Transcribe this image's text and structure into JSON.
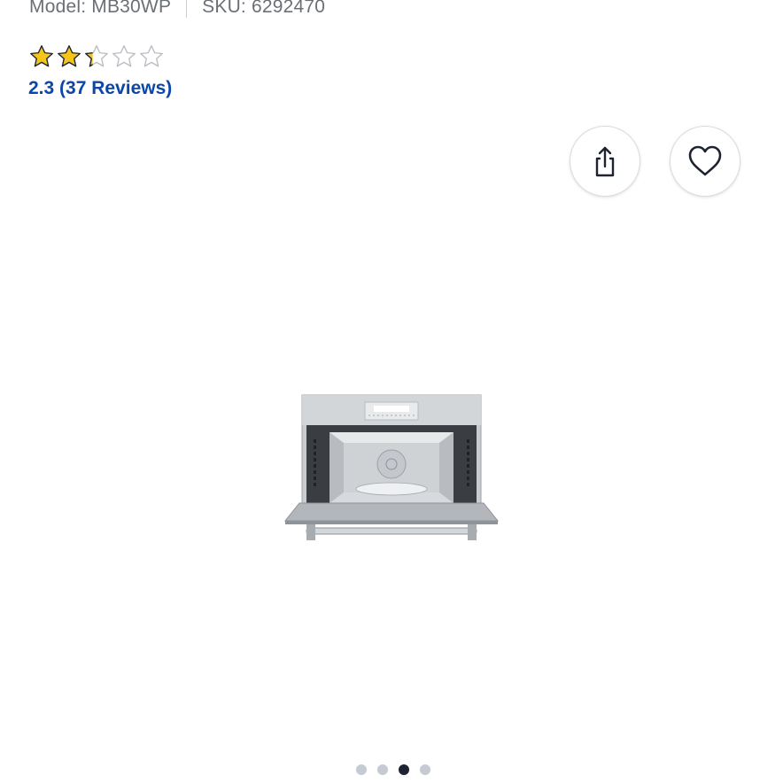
{
  "product": {
    "model": "Model: MB30WP",
    "sku": "SKU: 6292470",
    "rating": {
      "value": 2.3,
      "max": 5,
      "text": "2.3 (37 Reviews)"
    }
  },
  "actions": {
    "share_icon": "share-icon",
    "wishlist_icon": "heart-icon"
  },
  "gallery": {
    "image_subject": "built-in microwave oven with door open",
    "dot_count": 4,
    "active_index": 2
  },
  "colors": {
    "link": "#0b46a8",
    "star_fill": "#f5c518",
    "star_outline": "#b9bdc4",
    "dot_active": "#1d2330",
    "dot_inactive": "#c5cad3"
  }
}
